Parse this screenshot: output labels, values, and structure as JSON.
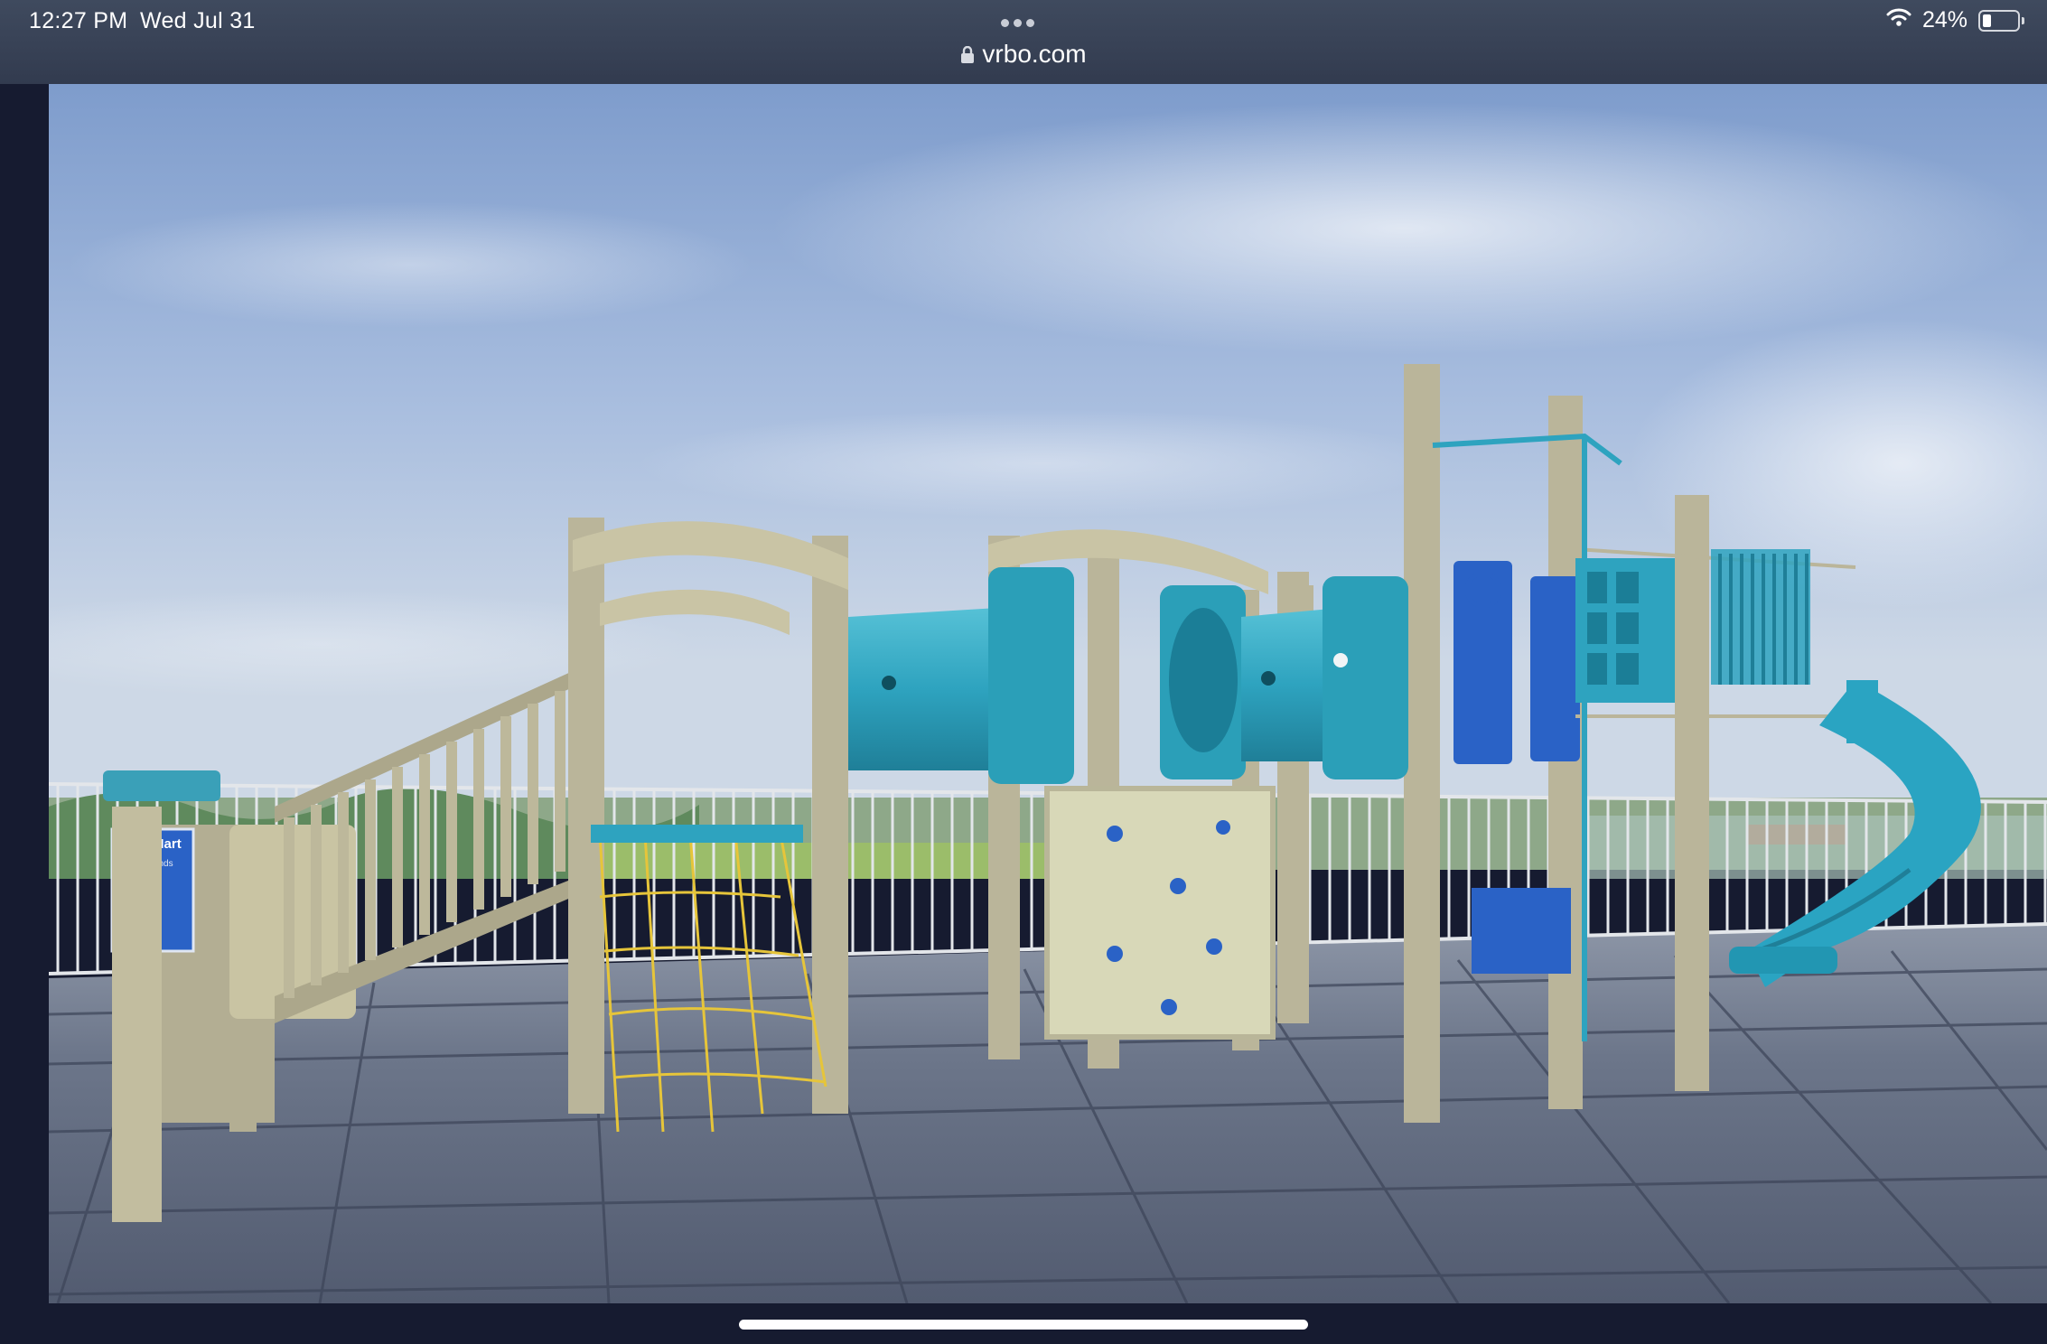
{
  "status_bar": {
    "time": "12:27 PM",
    "date": "Wed Jul 31",
    "battery_percent": "24%",
    "battery_level": 0.24
  },
  "browser": {
    "url": "vrbo.com",
    "lock_icon": "lock-icon",
    "more_icon": "ellipsis-icon"
  },
  "photo": {
    "sign_title": "Play Mart",
    "sign_subtitle": "Playgrounds"
  },
  "colors": {
    "tube": "#2ea3bf",
    "panel_blue": "#2a62c6",
    "post": "#b8b49a",
    "sky_top": "#7f9fcf",
    "floor": "#596379"
  }
}
